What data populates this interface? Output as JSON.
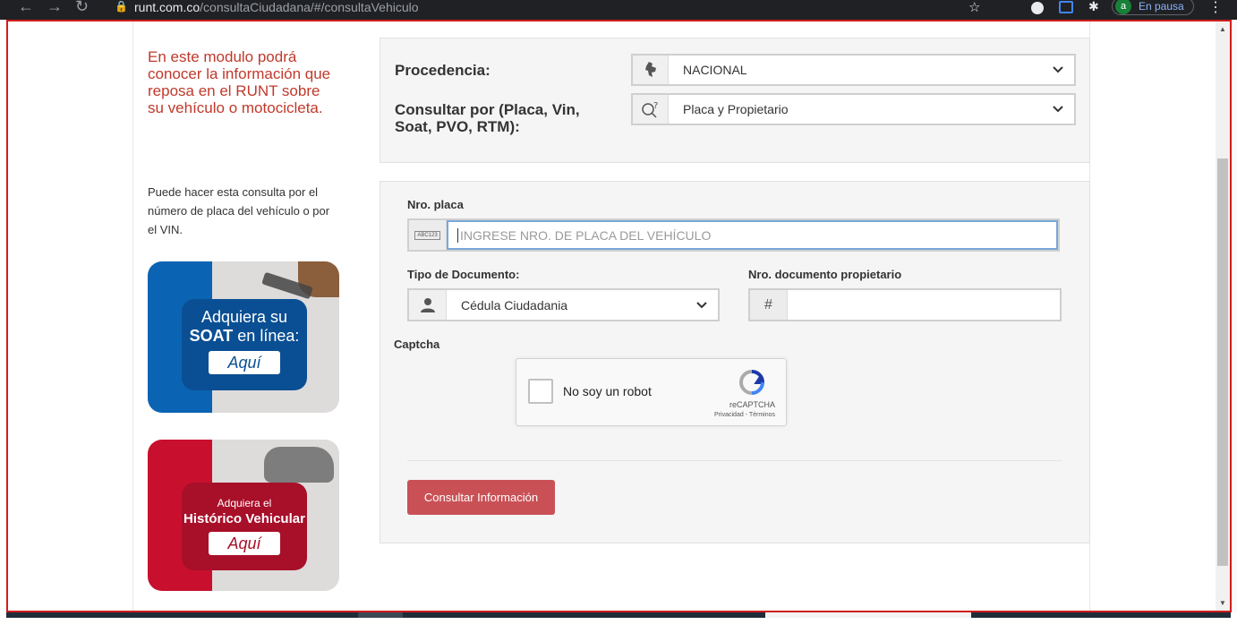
{
  "browser": {
    "url_host": "runt.com.co",
    "url_path": "/consultaCiudadana/#/consultaVehiculo",
    "profile_initial": "a",
    "profile_status": "En pausa"
  },
  "intro": {
    "text": "En este modulo podrá conocer la información que reposa en el RUNT sobre su vehículo o motocicleta.",
    "description": "Puede hacer esta consulta por el número de placa del vehículo o por el VIN."
  },
  "promos": {
    "soat": {
      "line1": "Adquiera su",
      "line2_bold": "SOAT",
      "line2_rest": " en línea:",
      "cta": "Aquí"
    },
    "historico": {
      "line1": "Adquiera el",
      "line2": "Histórico Vehicular",
      "cta": "Aquí"
    }
  },
  "query": {
    "procedencia_label": "Procedencia:",
    "procedencia_value": "NACIONAL",
    "consultar_label": "Consultar por (Placa, Vin, Soat, PVO, RTM):",
    "consultar_value": "Placa y Propietario"
  },
  "form": {
    "placa_label": "Nro. placa",
    "placa_addon": "ABC123",
    "placa_placeholder": "INGRESE NRO. DE PLACA DEL VEHÍCULO",
    "tipo_doc_label": "Tipo de Documento:",
    "tipo_doc_value": "Cédula Ciudadania",
    "nro_doc_label": "Nro. documento propietario",
    "nro_doc_addon": "#",
    "captcha_label": "Captcha",
    "captcha_text": "No soy un robot",
    "captcha_brand": "reCAPTCHA",
    "captcha_terms": "Privacidad - Términos",
    "submit_label": "Consultar Información"
  },
  "colors": {
    "accent_red": "#c95156",
    "intro_red": "#c0392b",
    "soat_blue": "#0a4f93",
    "historico_red": "#a80f29"
  },
  "icons": {
    "procedencia": "colombia-map-icon",
    "consultar": "search-question-icon",
    "tipo_doc": "user-icon",
    "placa": "license-plate-icon"
  }
}
